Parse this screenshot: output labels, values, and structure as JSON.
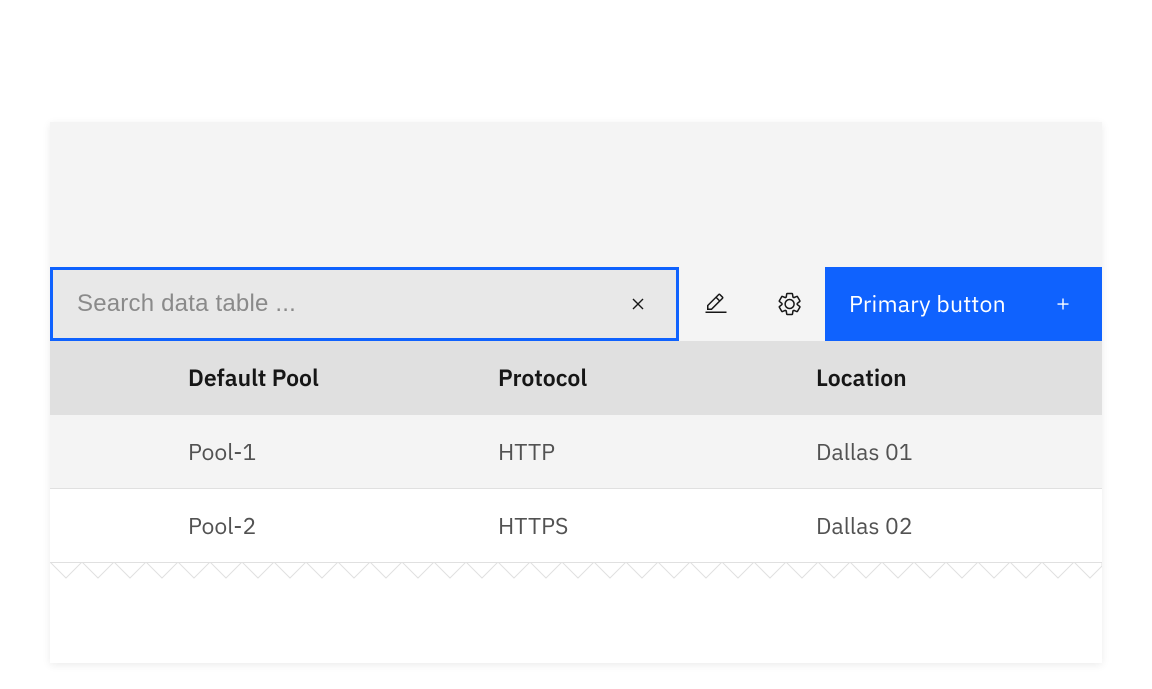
{
  "toolbar": {
    "search_placeholder": "Search data table ...",
    "search_value": "",
    "primary_button_label": "Primary button"
  },
  "table": {
    "columns": {
      "pool": "Default Pool",
      "protocol": "Protocol",
      "location": "Location"
    },
    "rows": [
      {
        "pool": "Pool-1",
        "protocol": "HTTP",
        "location": "Dallas 01"
      },
      {
        "pool": "Pool-2",
        "protocol": "HTTPS",
        "location": "Dallas 02"
      }
    ]
  },
  "colors": {
    "primary": "#0f62fe",
    "bg": "#f4f4f4",
    "header_bg": "#e0e0e0"
  }
}
